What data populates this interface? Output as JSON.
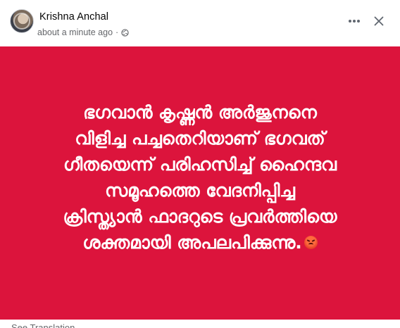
{
  "post": {
    "author_name": "Krishna Anchal",
    "timestamp": "about a minute ago",
    "separator": "·",
    "privacy_icon": "globe-icon",
    "more_icon": "more-horizontal-icon",
    "close_icon": "close-icon"
  },
  "card": {
    "background_color": "#dc143c",
    "text_color": "#ffffff",
    "lines": [
      "ഭഗവാൻ കൃഷ്ണൻ അർജുനനെ",
      "വിളിച്ച പച്ചതെറിയാണ് ഭഗവത്",
      "ഗീതയെന്ന് പരിഹസിച്ച് ഹൈന്ദവ",
      "സമൂഹത്തെ വേദനിപ്പിച്ച",
      "ക്രിസ്ത്യാൻ ഫാദറുടെ പ്രവർത്തിയെ",
      "ശക്തമായി അപലപിക്കുന്നു."
    ],
    "trailing_emoji": "angry-face-icon"
  },
  "footer": {
    "see_translation": "See Translation"
  }
}
